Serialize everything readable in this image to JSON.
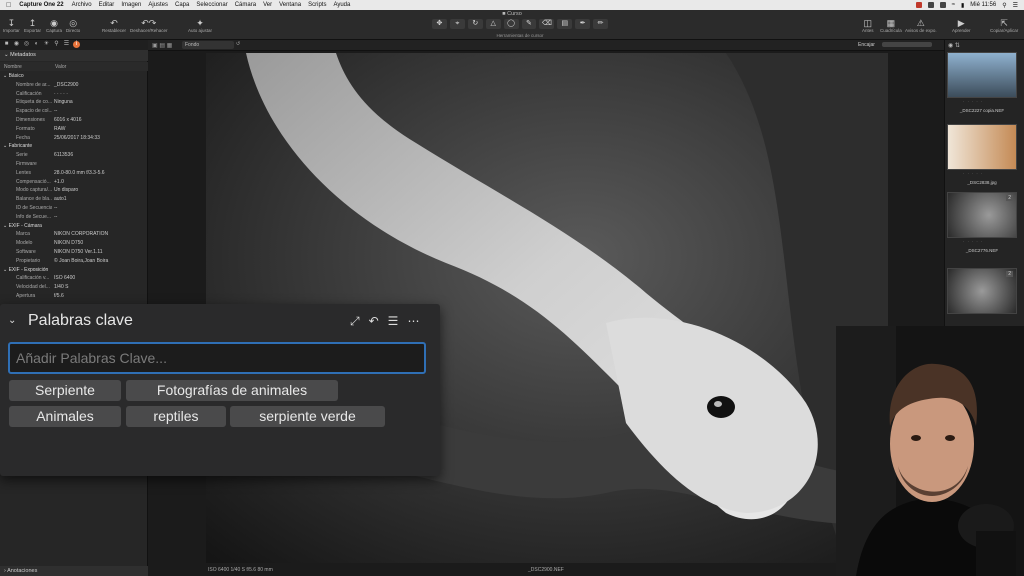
{
  "menubar": {
    "app_name": "Capture One 22",
    "items": [
      "Archivo",
      "Editar",
      "Imagen",
      "Ajustes",
      "Capa",
      "Seleccionar",
      "Cámara",
      "Ver",
      "Ventana",
      "Scripts",
      "Ayuda"
    ],
    "clock": "Mié 11:56"
  },
  "toolbar": {
    "doc_title": "Curso",
    "left_buttons": [
      {
        "label": "Importar",
        "icon": "import-icon"
      },
      {
        "label": "Exportar",
        "icon": "export-icon"
      },
      {
        "label": "Captura",
        "icon": "capture-icon"
      },
      {
        "label": "Directo",
        "icon": "live-icon"
      }
    ],
    "restore_label": "Restablecer",
    "undo_label": "Deshacer/Rehacer",
    "auto_label": "Auto ajustar",
    "cursor_tools_label": "Herramientas de cursor",
    "right_buttons": [
      {
        "label": "Antes"
      },
      {
        "label": "Cuadrícula"
      },
      {
        "label": "Avisos de expo."
      },
      {
        "label": "Aprender"
      },
      {
        "label": "Copiar/Aplicar"
      }
    ]
  },
  "left_panel": {
    "header": "Metadatos",
    "col_name": "Nombre",
    "col_value": "Valor",
    "rows": [
      {
        "section": "Básico"
      },
      {
        "k": "Nombre de ar...",
        "v": "_DSC2900"
      },
      {
        "k": "Calificación",
        "v": "· · · · ·"
      },
      {
        "k": "Etiqueta de co...",
        "v": "Ninguna"
      },
      {
        "k": "Espacio de col...",
        "v": "--"
      },
      {
        "k": "Dimensiones",
        "v": "6016 x 4016"
      },
      {
        "k": "Formato",
        "v": "RAW"
      },
      {
        "k": "Fecha",
        "v": "25/06/2017 18:34:33"
      },
      {
        "section": "Fabricante"
      },
      {
        "k": "Serie",
        "v": "6113536"
      },
      {
        "k": "Firmware",
        "v": ""
      },
      {
        "k": "Lentes",
        "v": "28.0-80.0 mm f/3.3-5.6"
      },
      {
        "k": "Compensació...",
        "v": "+1.0"
      },
      {
        "k": "Modo captura/...",
        "v": "Un disparo"
      },
      {
        "k": "Balance de bla...",
        "v": "auto1"
      },
      {
        "k": "ID de Secuencia",
        "v": "--"
      },
      {
        "k": "Info de Secue...",
        "v": "--"
      },
      {
        "section": "EXIF - Cámara"
      },
      {
        "k": "Marca",
        "v": "NIKON CORPORATION"
      },
      {
        "k": "Modelo",
        "v": "NIKON D750"
      },
      {
        "k": "Software",
        "v": "NIKON D750 Ver.1.11"
      },
      {
        "k": "Propietario",
        "v": "© Joan Boira,Joan Boira"
      },
      {
        "section": "EXIF - Exposición"
      },
      {
        "k": "Calificación v...",
        "v": "ISO 6400"
      },
      {
        "k": "Velocidad del...",
        "v": "1/40 S"
      },
      {
        "k": "Apertura",
        "v": "f/5.6"
      }
    ],
    "annotations_label": "Anotaciones"
  },
  "viewer": {
    "background_select": "Fondo",
    "fit_label": "Encajar",
    "status_exif": "ISO 6400    1/40 S    f/5.6    80 mm",
    "status_filename": "_DSC2900.NEF"
  },
  "browser": {
    "thumbs": [
      {
        "name": "_DSC2227 copia.NEF"
      },
      {
        "name": "_DSC2838.jpg"
      },
      {
        "name": "_DSC2776.NEF",
        "badge": "2"
      },
      {
        "name": "",
        "badge": "2"
      }
    ]
  },
  "keywords": {
    "title": "Palabras clave",
    "input_placeholder": "Añadir Palabras Clave...",
    "chips_row1": [
      "Serpiente",
      "Fotografías de animales"
    ],
    "chips_row2": [
      "Animales",
      "reptiles",
      "serpiente verde"
    ]
  },
  "colors": {
    "accent_orange": "#e8743b",
    "input_focus": "#2f6fb5",
    "panel_bg": "#2a2a2b",
    "chip_bg": "#4a4a4b"
  }
}
